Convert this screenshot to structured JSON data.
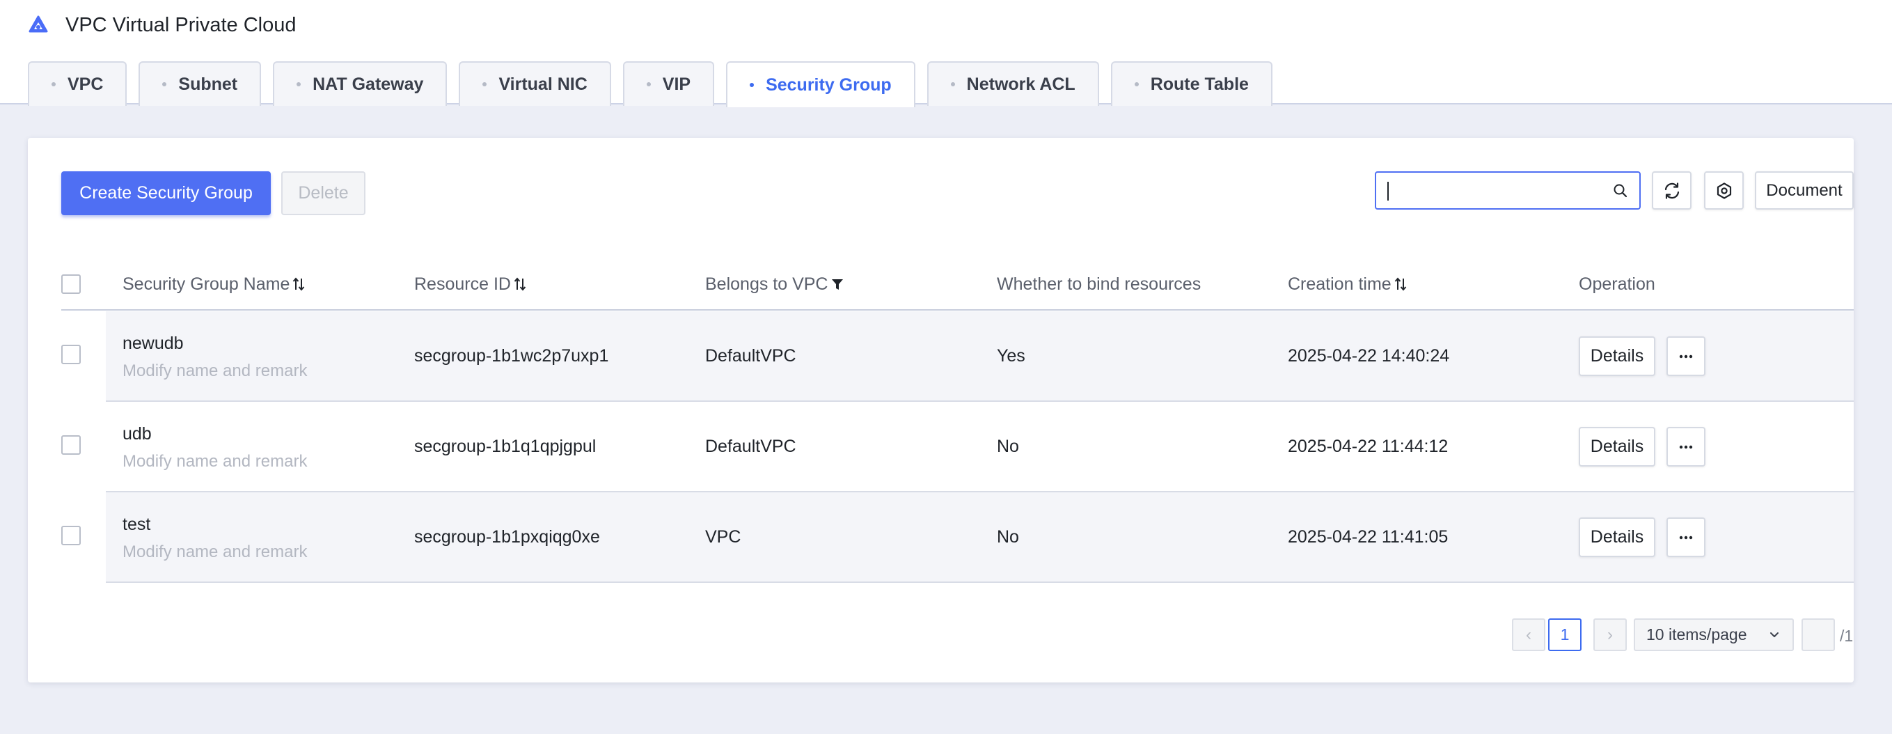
{
  "app": {
    "title": "VPC Virtual Private Cloud",
    "logo_icon": "cloud-logo-icon"
  },
  "tabs": [
    {
      "label": "VPC",
      "active": false
    },
    {
      "label": "Subnet",
      "active": false
    },
    {
      "label": "NAT Gateway",
      "active": false
    },
    {
      "label": "Virtual NIC",
      "active": false
    },
    {
      "label": "VIP",
      "active": false
    },
    {
      "label": "Security Group",
      "active": true
    },
    {
      "label": "Network ACL",
      "active": false
    },
    {
      "label": "Route Table",
      "active": false
    }
  ],
  "toolbar": {
    "create_label": "Create Security Group",
    "delete_label": "Delete",
    "search_value": "",
    "document_label": "Document"
  },
  "table": {
    "columns": [
      {
        "label": "Security Group Name",
        "icon": "sort-icon"
      },
      {
        "label": "Resource ID",
        "icon": "sort-icon"
      },
      {
        "label": "Belongs to VPC",
        "icon": "filter-icon"
      },
      {
        "label": "Whether to bind resources",
        "icon": ""
      },
      {
        "label": "Creation time",
        "icon": "sort-icon"
      },
      {
        "label": "Operation",
        "icon": ""
      }
    ],
    "rows": [
      {
        "name": "newudb",
        "remark": "Modify name and remark",
        "resource_id": "secgroup-1b1wc2p7uxp1",
        "vpc": "DefaultVPC",
        "bound": "Yes",
        "created": "2025-04-22 14:40:24",
        "details": "Details"
      },
      {
        "name": "udb",
        "remark": "Modify name and remark",
        "resource_id": "secgroup-1b1q1qpjgpul",
        "vpc": "DefaultVPC",
        "bound": "No",
        "created": "2025-04-22 11:44:12",
        "details": "Details"
      },
      {
        "name": "test",
        "remark": "Modify name and remark",
        "resource_id": "secgroup-1b1pxqiqg0xe",
        "vpc": "VPC",
        "bound": "No",
        "created": "2025-04-22 11:41:05",
        "details": "Details"
      }
    ]
  },
  "pagination": {
    "prev": "‹",
    "next": "›",
    "current_page": "1",
    "page_size": "10 items/page",
    "jump_value": "",
    "total": "/1"
  },
  "colors": {
    "accent": "#3d6bf0",
    "primary_button": "#4f6ff3",
    "background": "#eceef6"
  }
}
